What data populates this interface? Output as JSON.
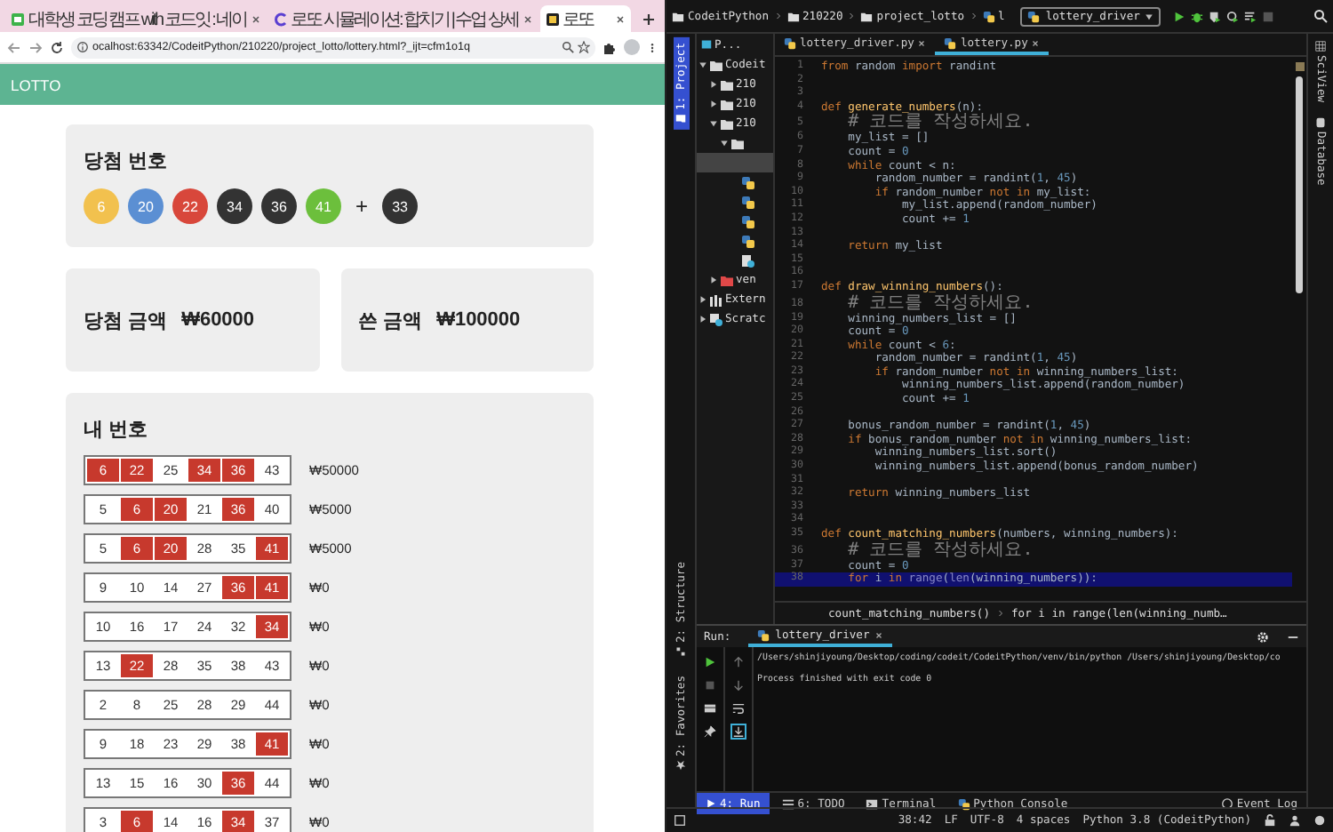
{
  "browser": {
    "tabs": [
      {
        "title": "대학생 코딩 캠프 with 코드잇 : 네이",
        "kind": "robot",
        "selected": false
      },
      {
        "title": "로또 시뮬레이션: 합치기 | 수업 상세",
        "kind": "ring",
        "selected": false
      },
      {
        "title": "로또",
        "kind": "tile",
        "selected": true
      }
    ],
    "url": "ocalhost:63342/CodeitPython/210220/project_lotto/lottery.html?_ijt=cfm1o1q"
  },
  "app": {
    "title": "LOTTO",
    "winning": {
      "title": "당첨 번호",
      "balls": [
        {
          "n": "6",
          "color": "#f2c14e"
        },
        {
          "n": "20",
          "color": "#5b8fd3"
        },
        {
          "n": "22",
          "color": "#d8473b"
        },
        {
          "n": "34",
          "color": "#333333"
        },
        {
          "n": "36",
          "color": "#333333"
        },
        {
          "n": "41",
          "color": "#6cbf3c"
        }
      ],
      "plus": "+",
      "bonus": {
        "n": "33",
        "color": "#333333"
      }
    },
    "totals": [
      {
        "label": "당첨 금액",
        "value": "₩60000"
      },
      {
        "label": "쓴 금액",
        "value": "₩100000"
      }
    ],
    "mine": {
      "title": "내 번호",
      "rows": [
        {
          "numbers": [
            {
              "n": "6",
              "matched": true
            },
            {
              "n": "22",
              "matched": true
            },
            {
              "n": "25",
              "matched": false
            },
            {
              "n": "34",
              "matched": true
            },
            {
              "n": "36",
              "matched": true
            },
            {
              "n": "43",
              "matched": false
            }
          ],
          "prize": "₩50000"
        },
        {
          "numbers": [
            {
              "n": "5",
              "matched": false
            },
            {
              "n": "6",
              "matched": true
            },
            {
              "n": "20",
              "matched": true
            },
            {
              "n": "21",
              "matched": false
            },
            {
              "n": "36",
              "matched": true
            },
            {
              "n": "40",
              "matched": false
            }
          ],
          "prize": "₩5000"
        },
        {
          "numbers": [
            {
              "n": "5",
              "matched": false
            },
            {
              "n": "6",
              "matched": true
            },
            {
              "n": "20",
              "matched": true
            },
            {
              "n": "28",
              "matched": false
            },
            {
              "n": "35",
              "matched": false
            },
            {
              "n": "41",
              "matched": true
            }
          ],
          "prize": "₩5000"
        },
        {
          "numbers": [
            {
              "n": "9",
              "matched": false
            },
            {
              "n": "10",
              "matched": false
            },
            {
              "n": "14",
              "matched": false
            },
            {
              "n": "27",
              "matched": false
            },
            {
              "n": "36",
              "matched": true
            },
            {
              "n": "41",
              "matched": true
            }
          ],
          "prize": "₩0"
        },
        {
          "numbers": [
            {
              "n": "10",
              "matched": false
            },
            {
              "n": "16",
              "matched": false
            },
            {
              "n": "17",
              "matched": false
            },
            {
              "n": "24",
              "matched": false
            },
            {
              "n": "32",
              "matched": false
            },
            {
              "n": "34",
              "matched": true
            }
          ],
          "prize": "₩0"
        },
        {
          "numbers": [
            {
              "n": "13",
              "matched": false
            },
            {
              "n": "22",
              "matched": true
            },
            {
              "n": "28",
              "matched": false
            },
            {
              "n": "35",
              "matched": false
            },
            {
              "n": "38",
              "matched": false
            },
            {
              "n": "43",
              "matched": false
            }
          ],
          "prize": "₩0"
        },
        {
          "numbers": [
            {
              "n": "2",
              "matched": false
            },
            {
              "n": "8",
              "matched": false
            },
            {
              "n": "25",
              "matched": false
            },
            {
              "n": "28",
              "matched": false
            },
            {
              "n": "29",
              "matched": false
            },
            {
              "n": "44",
              "matched": false
            }
          ],
          "prize": "₩0"
        },
        {
          "numbers": [
            {
              "n": "9",
              "matched": false
            },
            {
              "n": "18",
              "matched": false
            },
            {
              "n": "23",
              "matched": false
            },
            {
              "n": "29",
              "matched": false
            },
            {
              "n": "38",
              "matched": false
            },
            {
              "n": "41",
              "matched": true
            }
          ],
          "prize": "₩0"
        },
        {
          "numbers": [
            {
              "n": "13",
              "matched": false
            },
            {
              "n": "15",
              "matched": false
            },
            {
              "n": "16",
              "matched": false
            },
            {
              "n": "30",
              "matched": false
            },
            {
              "n": "36",
              "matched": true
            },
            {
              "n": "44",
              "matched": false
            }
          ],
          "prize": "₩0"
        },
        {
          "numbers": [
            {
              "n": "3",
              "matched": false
            },
            {
              "n": "6",
              "matched": true
            },
            {
              "n": "14",
              "matched": false
            },
            {
              "n": "16",
              "matched": false
            },
            {
              "n": "34",
              "matched": true
            },
            {
              "n": "37",
              "matched": false
            }
          ],
          "prize": "₩0"
        }
      ]
    }
  },
  "ide": {
    "path": [
      "CodeitPython",
      "210220",
      "project_lotto",
      "l"
    ],
    "run_config": "lottery_driver",
    "left_tabs_top": [
      {
        "label": "1: Project",
        "selected": true
      }
    ],
    "left_tabs_bottom": [
      {
        "label": "2: Structure",
        "kind": "structure",
        "selected": false
      },
      {
        "label": "2: Favorites",
        "kind": "favorites",
        "selected": false
      }
    ],
    "right_tabs": [
      {
        "label": "SciView",
        "kind": "grid"
      },
      {
        "label": "Database",
        "kind": "db"
      }
    ],
    "project_panel": {
      "title": "P...",
      "tree": [
        {
          "name": "Codeit",
          "kind": "folder",
          "expanded": true,
          "selected": false,
          "children": [
            {
              "name": "210",
              "kind": "folder",
              "expanded": false,
              "selected": false
            },
            {
              "name": "210",
              "kind": "folder",
              "expanded": false,
              "selected": false
            },
            {
              "name": "210",
              "kind": "folder",
              "expanded": true,
              "selected": false,
              "children": [
                {
                  "kind": "folder",
                  "expanded": true,
                  "selected": false,
                  "children": [
                    {
                      "kind": "row",
                      "selected": true
                    },
                    {
                      "kind": "py",
                      "selected": false
                    },
                    {
                      "kind": "py",
                      "selected": false
                    },
                    {
                      "kind": "py",
                      "selected": false
                    },
                    {
                      "kind": "py",
                      "selected": false
                    },
                    {
                      "kind": "script",
                      "selected": false
                    }
                  ]
                }
              ]
            },
            {
              "name": "ven",
              "kind": "venv",
              "expanded": false,
              "selected": false
            }
          ]
        },
        {
          "name": "Extern",
          "kind": "library",
          "expanded": false,
          "selected": false
        },
        {
          "name": "Scratc",
          "kind": "scratch",
          "expanded": false,
          "selected": false
        }
      ]
    },
    "editor_tabs": [
      {
        "label": "lottery_driver.py",
        "selected": false
      },
      {
        "label": "lottery.py",
        "selected": true
      }
    ],
    "lines": [
      {
        "n": "1",
        "cur": false,
        "s": [
          {
            "kind": "keyword",
            "text": "from"
          },
          {
            "kind": "plain",
            "text": " random "
          },
          {
            "kind": "keyword",
            "text": "import"
          },
          {
            "kind": "plain",
            "text": " randint"
          }
        ]
      },
      {
        "n": "2",
        "cur": false
      },
      {
        "n": "3",
        "cur": false
      },
      {
        "n": "4",
        "cur": false,
        "s": [
          {
            "kind": "keyword",
            "text": "def "
          },
          {
            "kind": "function",
            "text": "generate_numbers"
          },
          {
            "kind": "plain",
            "text": "(n):"
          }
        ]
      },
      {
        "n": "5",
        "cur": false,
        "s": [
          {
            "kind": "comment",
            "text": "    # 코드를 작성하세요."
          }
        ]
      },
      {
        "n": "6",
        "cur": false,
        "s": [
          {
            "kind": "plain",
            "text": "    my_list = []"
          }
        ]
      },
      {
        "n": "7",
        "cur": false,
        "s": [
          {
            "kind": "plain",
            "text": "    count = "
          },
          {
            "kind": "number",
            "text": "0"
          }
        ]
      },
      {
        "n": "8",
        "cur": false,
        "s": [
          {
            "kind": "keyword",
            "text": "    while"
          },
          {
            "kind": "plain",
            "text": " count < n:"
          }
        ]
      },
      {
        "n": "9",
        "cur": false,
        "s": [
          {
            "kind": "plain",
            "text": "        random_number = randint("
          },
          {
            "kind": "number",
            "text": "1"
          },
          {
            "kind": "plain",
            "text": ", "
          },
          {
            "kind": "number",
            "text": "45"
          },
          {
            "kind": "plain",
            "text": ")"
          }
        ]
      },
      {
        "n": "10",
        "cur": false,
        "s": [
          {
            "kind": "keyword",
            "text": "        if"
          },
          {
            "kind": "plain",
            "text": " random_number "
          },
          {
            "kind": "keyword",
            "text": "not in"
          },
          {
            "kind": "plain",
            "text": " my_list:"
          }
        ]
      },
      {
        "n": "11",
        "cur": false,
        "s": [
          {
            "kind": "plain",
            "text": "            my_list.append(random_number)"
          }
        ]
      },
      {
        "n": "12",
        "cur": false,
        "s": [
          {
            "kind": "plain",
            "text": "            count += "
          },
          {
            "kind": "number",
            "text": "1"
          }
        ]
      },
      {
        "n": "13",
        "cur": false
      },
      {
        "n": "14",
        "cur": false,
        "s": [
          {
            "kind": "keyword",
            "text": "    return"
          },
          {
            "kind": "plain",
            "text": " my_list"
          }
        ]
      },
      {
        "n": "15",
        "cur": false
      },
      {
        "n": "16",
        "cur": false
      },
      {
        "n": "17",
        "cur": false,
        "s": [
          {
            "kind": "keyword",
            "text": "def "
          },
          {
            "kind": "function",
            "text": "draw_winning_numbers"
          },
          {
            "kind": "plain",
            "text": "():"
          }
        ]
      },
      {
        "n": "18",
        "cur": false,
        "s": [
          {
            "kind": "comment",
            "text": "    # 코드를 작성하세요."
          }
        ]
      },
      {
        "n": "19",
        "cur": false,
        "s": [
          {
            "kind": "plain",
            "text": "    winning_numbers_list = []"
          }
        ]
      },
      {
        "n": "20",
        "cur": false,
        "s": [
          {
            "kind": "plain",
            "text": "    count = "
          },
          {
            "kind": "number",
            "text": "0"
          }
        ]
      },
      {
        "n": "21",
        "cur": false,
        "s": [
          {
            "kind": "keyword",
            "text": "    while"
          },
          {
            "kind": "plain",
            "text": " count < "
          },
          {
            "kind": "number",
            "text": "6"
          },
          {
            "kind": "plain",
            "text": ":"
          }
        ]
      },
      {
        "n": "22",
        "cur": false,
        "s": [
          {
            "kind": "plain",
            "text": "        random_number = randint("
          },
          {
            "kind": "number",
            "text": "1"
          },
          {
            "kind": "plain",
            "text": ", "
          },
          {
            "kind": "number",
            "text": "45"
          },
          {
            "kind": "plain",
            "text": ")"
          }
        ]
      },
      {
        "n": "23",
        "cur": false,
        "s": [
          {
            "kind": "keyword",
            "text": "        if"
          },
          {
            "kind": "plain",
            "text": " random_number "
          },
          {
            "kind": "keyword",
            "text": "not in"
          },
          {
            "kind": "plain",
            "text": " winning_numbers_list:"
          }
        ]
      },
      {
        "n": "24",
        "cur": false,
        "s": [
          {
            "kind": "plain",
            "text": "            winning_numbers_list.append(random_number)"
          }
        ]
      },
      {
        "n": "25",
        "cur": false,
        "s": [
          {
            "kind": "plain",
            "text": "            count += "
          },
          {
            "kind": "number",
            "text": "1"
          }
        ]
      },
      {
        "n": "26",
        "cur": false
      },
      {
        "n": "27",
        "cur": false,
        "s": [
          {
            "kind": "plain",
            "text": "    bonus_random_number = randint("
          },
          {
            "kind": "number",
            "text": "1"
          },
          {
            "kind": "plain",
            "text": ", "
          },
          {
            "kind": "number",
            "text": "45"
          },
          {
            "kind": "plain",
            "text": ")"
          }
        ]
      },
      {
        "n": "28",
        "cur": false,
        "s": [
          {
            "kind": "keyword",
            "text": "    if"
          },
          {
            "kind": "plain",
            "text": " bonus_random_number "
          },
          {
            "kind": "keyword",
            "text": "not in"
          },
          {
            "kind": "plain",
            "text": " winning_numbers_list:"
          }
        ]
      },
      {
        "n": "29",
        "cur": false,
        "s": [
          {
            "kind": "plain",
            "text": "        winning_numbers_list.sort()"
          }
        ]
      },
      {
        "n": "30",
        "cur": false,
        "s": [
          {
            "kind": "plain",
            "text": "        winning_numbers_list.append(bonus_random_number)"
          }
        ]
      },
      {
        "n": "31",
        "cur": false
      },
      {
        "n": "32",
        "cur": false,
        "s": [
          {
            "kind": "keyword",
            "text": "    return"
          },
          {
            "kind": "plain",
            "text": " winning_numbers_list"
          }
        ]
      },
      {
        "n": "33",
        "cur": false
      },
      {
        "n": "34",
        "cur": false
      },
      {
        "n": "35",
        "cur": false,
        "s": [
          {
            "kind": "keyword",
            "text": "def "
          },
          {
            "kind": "function",
            "text": "count_matching_numbers"
          },
          {
            "kind": "plain",
            "text": "(numbers, winning_numbers):"
          }
        ]
      },
      {
        "n": "36",
        "cur": false,
        "s": [
          {
            "kind": "comment",
            "text": "    # 코드를 작성하세요."
          }
        ]
      },
      {
        "n": "37",
        "cur": false,
        "s": [
          {
            "kind": "plain",
            "text": "    count = "
          },
          {
            "kind": "number",
            "text": "0"
          }
        ]
      },
      {
        "n": "38",
        "cur": true,
        "s": [
          {
            "kind": "keyword",
            "text": "    for"
          },
          {
            "kind": "plain",
            "text": " i "
          },
          {
            "kind": "keyword",
            "text": "in "
          },
          {
            "kind": "builtin",
            "text": "range"
          },
          {
            "kind": "plain",
            "text": "("
          },
          {
            "kind": "builtin",
            "text": "len"
          },
          {
            "kind": "plain",
            "text": "(winning_numbers)):"
          }
        ]
      }
    ],
    "code_path": [
      "count_matching_numbers()",
      "for i in range(len(winning_numb…"
    ],
    "run": {
      "label": "Run:",
      "tab": "lottery_driver",
      "output": [
        "/Users/shinjiyoung/Desktop/coding/codeit/CodeitPython/venv/bin/python /Users/shinjiyoung/Desktop/co",
        "Process finished with exit code 0"
      ]
    },
    "tool_tabs": [
      {
        "label": "4: Run",
        "kind": "run",
        "selected": true
      },
      {
        "label": "6: TODO",
        "kind": "todo",
        "selected": false
      },
      {
        "label": "Terminal",
        "kind": "terminal",
        "selected": false
      },
      {
        "label": "Python Console",
        "kind": "console",
        "selected": false
      }
    ],
    "event_log": "Event Log",
    "status": [
      "38:42",
      "LF",
      "UTF-8",
      "4 spaces",
      "Python 3.8 (CodeitPython)"
    ]
  }
}
